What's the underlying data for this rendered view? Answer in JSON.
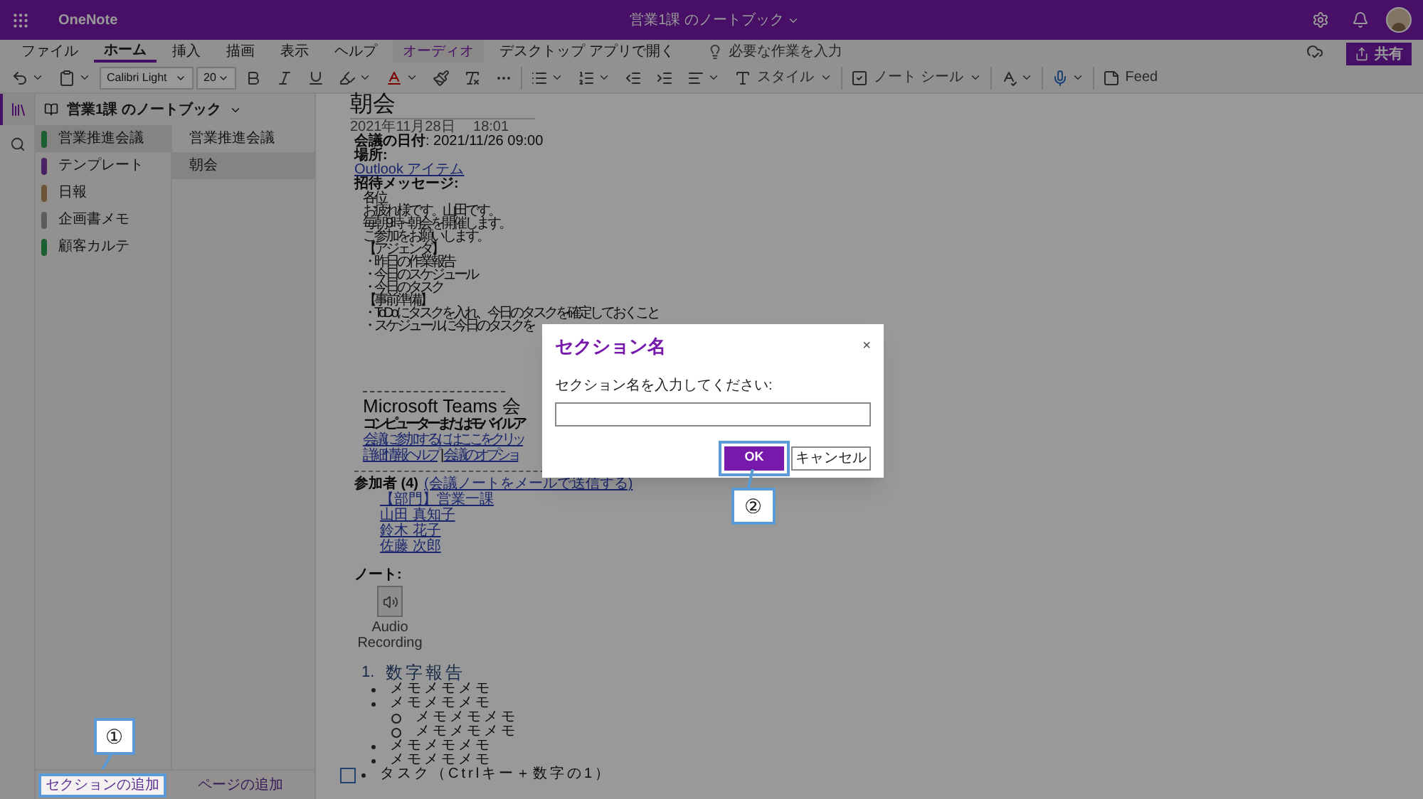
{
  "app_bar": {
    "app_name": "OneNote",
    "notebook_title": "営業1課 のノートブック"
  },
  "menu_tabs": [
    {
      "label": "ファイル",
      "selected": false
    },
    {
      "label": "ホーム",
      "selected": true
    },
    {
      "label": "挿入",
      "selected": false
    },
    {
      "label": "描画",
      "selected": false
    },
    {
      "label": "表示",
      "selected": false
    },
    {
      "label": "ヘルプ",
      "selected": false
    },
    {
      "label": "オーディオ",
      "selected": false,
      "kind": "contextual"
    },
    {
      "label": "デスクトップ アプリで開く",
      "selected": false
    }
  ],
  "tell_me": {
    "placeholder": "必要な作業を入力"
  },
  "share_button": "共有",
  "toolbar": {
    "font": "Calibri Light",
    "size": "20",
    "styles_label": "スタイル",
    "note_tags_label": "ノート シール",
    "feed_label": "Feed"
  },
  "notebook": {
    "title": "営業1課 のノートブック",
    "sections": [
      {
        "name": "営業推進会議",
        "color": "#1c5f30",
        "selected": true
      },
      {
        "name": "テンプレート",
        "color": "#4a2364",
        "selected": false
      },
      {
        "name": "日報",
        "color": "#6b5438",
        "selected": false
      },
      {
        "name": "企画書メモ",
        "color": "#5c5c5c",
        "selected": false
      },
      {
        "name": "顧客カルテ",
        "color": "#1c5f30",
        "selected": false
      }
    ],
    "pages": [
      {
        "title": "営業推進会議",
        "selected": false
      },
      {
        "title": "朝会",
        "selected": true
      }
    ],
    "add_section": "セクションの追加",
    "add_page": "ページの追加"
  },
  "page": {
    "title": "朝会",
    "timestamp": "2021年11月28日　 18:01",
    "meeting_date": "**会議の日付**: 2021/11/26 09:00",
    "location_label": "場所:",
    "outlook_link": "Outlook アイテム",
    "invite_label": "招待メッセージ:",
    "message_lines": [
      "各位",
      "お疲れ様です。山田です。",
      "毎朝9時~朝会を開催します。",
      "ご参加をお願いします。",
      "【アジェンダ】",
      "・昨日の作業報告",
      "・今日のスケジュール",
      "・今日のタスク",
      "【事前準備】",
      "・ToDoにタスクを入れ、今日のタスクを確定しておくこと",
      "・スケジュールに今日のタスクを"
    ],
    "teams": {
      "heading": "Microsoft Teams 会",
      "subheading": "コンピューターまたはモバイル ア",
      "join_link": "会議に参加するにはここをクリッ",
      "help_link": "詳細情報ヘルプ",
      "separator": "|",
      "options_link": "会議のオプショ"
    },
    "attendees": {
      "label": "参加者 (4)",
      "mail_link": "(会議ノートをメールで送信する)",
      "people": [
        "【部門】営業一課",
        "山田 真知子",
        "鈴木 花子",
        "佐藤 次郎"
      ]
    },
    "notes": {
      "label": "ノート:",
      "attachment": "Audio Recording"
    },
    "outline": {
      "number": "1.",
      "heading": "数字報告",
      "items": [
        {
          "text": "メモメモメモ"
        },
        {
          "text": "メモメモメモ",
          "children": [
            {
              "text": "メモメモメモ"
            },
            {
              "text": "メモメモメモ"
            }
          ]
        },
        {
          "text": "メモメモメモ"
        },
        {
          "text": "メモメモメモ"
        },
        {
          "text": "タスク（Ctrlキー＋数字の1）",
          "kind": "task",
          "checked": false
        }
      ]
    }
  },
  "dialog": {
    "title": "セクション名",
    "close": "×",
    "prompt": "セクション名を入力してください:",
    "ok": "OK",
    "cancel": "キャンセル"
  },
  "callouts": [
    "①",
    "②"
  ]
}
